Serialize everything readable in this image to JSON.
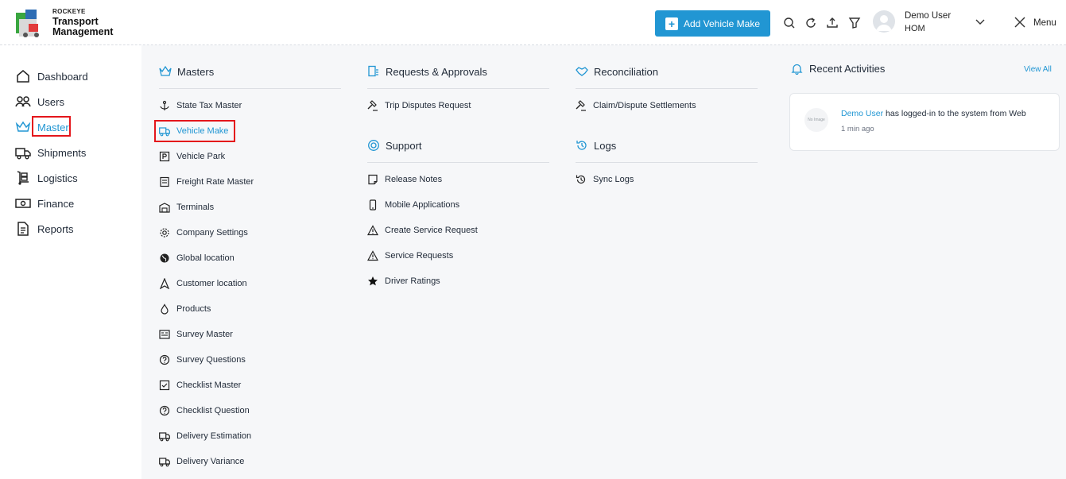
{
  "brand": {
    "company": "ROCKEYE",
    "line1": "Transport",
    "line2": "Management"
  },
  "header": {
    "add_button": "Add Vehicle Make",
    "user_name": "Demo User",
    "user_org": "HOM",
    "menu_label": "Menu"
  },
  "sidebar": {
    "items": [
      {
        "label": "Dashboard",
        "icon": "home-icon"
      },
      {
        "label": "Users",
        "icon": "users-icon"
      },
      {
        "label": "Master",
        "icon": "crown-icon",
        "active": true
      },
      {
        "label": "Shipments",
        "icon": "truck-icon"
      },
      {
        "label": "Logistics",
        "icon": "dolly-icon"
      },
      {
        "label": "Finance",
        "icon": "money-icon"
      },
      {
        "label": "Reports",
        "icon": "report-icon"
      }
    ]
  },
  "masters": {
    "title": "Masters",
    "items": [
      "State Tax Master",
      "Vehicle Make",
      "Vehicle Park",
      "Freight Rate Master",
      "Terminals",
      "Company Settings",
      "Global location",
      "Customer location",
      "Products",
      "Survey Master",
      "Survey Questions",
      "Checklist Master",
      "Checklist Question",
      "Delivery Estimation",
      "Delivery Variance"
    ]
  },
  "requests": {
    "title": "Requests & Approvals",
    "items": [
      "Trip Disputes Request"
    ]
  },
  "support": {
    "title": "Support",
    "items": [
      "Release Notes",
      "Mobile Applications",
      "Create Service Request",
      "Service Requests",
      "Driver Ratings"
    ]
  },
  "reconciliation": {
    "title": "Reconciliation",
    "items": [
      "Claim/Dispute Settlements"
    ]
  },
  "logs": {
    "title": "Logs",
    "items": [
      "Sync Logs"
    ]
  },
  "recent": {
    "title": "Recent Activities",
    "view_all": "View All",
    "activity": {
      "placeholder": "No Image",
      "user": "Demo User",
      "text": " has logged-in to the system from Web",
      "time": "1 min ago"
    }
  },
  "colors": {
    "accent": "#2196d3",
    "highlight": "#e4161b",
    "panel": "#f6f7f9"
  }
}
